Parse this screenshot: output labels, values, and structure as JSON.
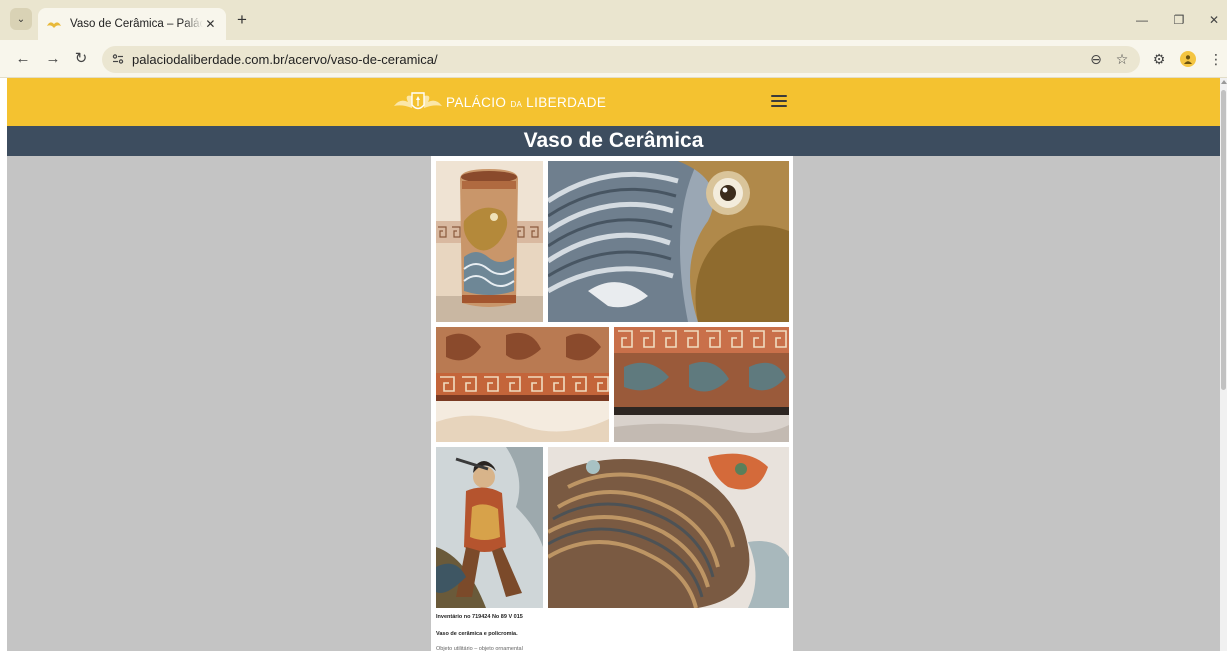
{
  "browser": {
    "tab_title": "Vaso de Cerâmica – Palácio da Liberdade",
    "url": "palaciodaliberdade.com.br/acervo/vaso-de-ceramica/",
    "close_glyph": "✕",
    "new_tab_glyph": "+",
    "minimize_glyph": "—",
    "restore_glyph": "❐",
    "window_close_glyph": "✕",
    "back_glyph": "←",
    "forward_glyph": "→",
    "reload_glyph": "↻",
    "zoom_glyph": "⊖",
    "bookmark_glyph": "☆",
    "extension_glyph": "⚙",
    "menu_glyph": "⋮",
    "tab_menu_glyph": "⌄"
  },
  "site": {
    "brand_main": "PALÁCIO",
    "brand_small": "DA",
    "brand_tail": "LIBERDADE",
    "header_color": "#f4c230",
    "title_bar_color": "#3d4d5f"
  },
  "page": {
    "title": "Vaso de Cerâmica",
    "caption_inventory": "Inventário no 719424 No 89 V 015",
    "caption_description": "Vaso de cerâmica e policromia.",
    "caption_type": "Objeto utilitário – objeto ornamental"
  },
  "gallery": [
    {
      "name": "vase-full-view",
      "subject": "vase-full"
    },
    {
      "name": "vase-fish-eye-detail",
      "subject": "fish-eye"
    },
    {
      "name": "vase-meander-border-top",
      "subject": "border-top"
    },
    {
      "name": "vase-meander-border-base",
      "subject": "border-base"
    },
    {
      "name": "vase-warrior-figure",
      "subject": "warrior"
    },
    {
      "name": "vase-dragon-scales-detail",
      "subject": "scales"
    }
  ]
}
